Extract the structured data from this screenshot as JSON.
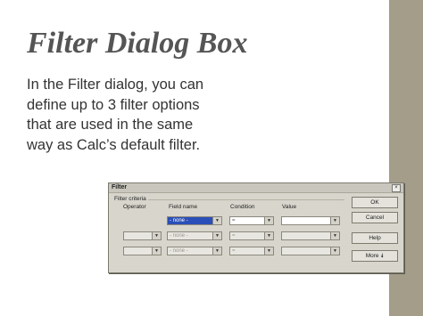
{
  "slide": {
    "title": "Filter Dialog Box",
    "body": "In the Filter dialog, you can define up to 3 filter options that are used in the same way as Calc’s default filter."
  },
  "dialog": {
    "title": "Filter",
    "close_glyph": "×",
    "group_label": "Filter criteria",
    "headers": {
      "operator": "Operator",
      "field": "Field name",
      "condition": "Condition",
      "value": "Value"
    },
    "rows": [
      {
        "operator": "",
        "field": "- none -",
        "condition": "=",
        "value": ""
      },
      {
        "operator": "",
        "field": "- none -",
        "condition": "=",
        "value": ""
      },
      {
        "operator": "",
        "field": "- none -",
        "condition": "=",
        "value": ""
      }
    ],
    "buttons": {
      "ok": "OK",
      "cancel": "Cancel",
      "help": "Help",
      "more": "More"
    },
    "more_glyph": "⯯"
  },
  "colors": {
    "band": "#a39d8a",
    "selection": "#2a4fb8"
  }
}
